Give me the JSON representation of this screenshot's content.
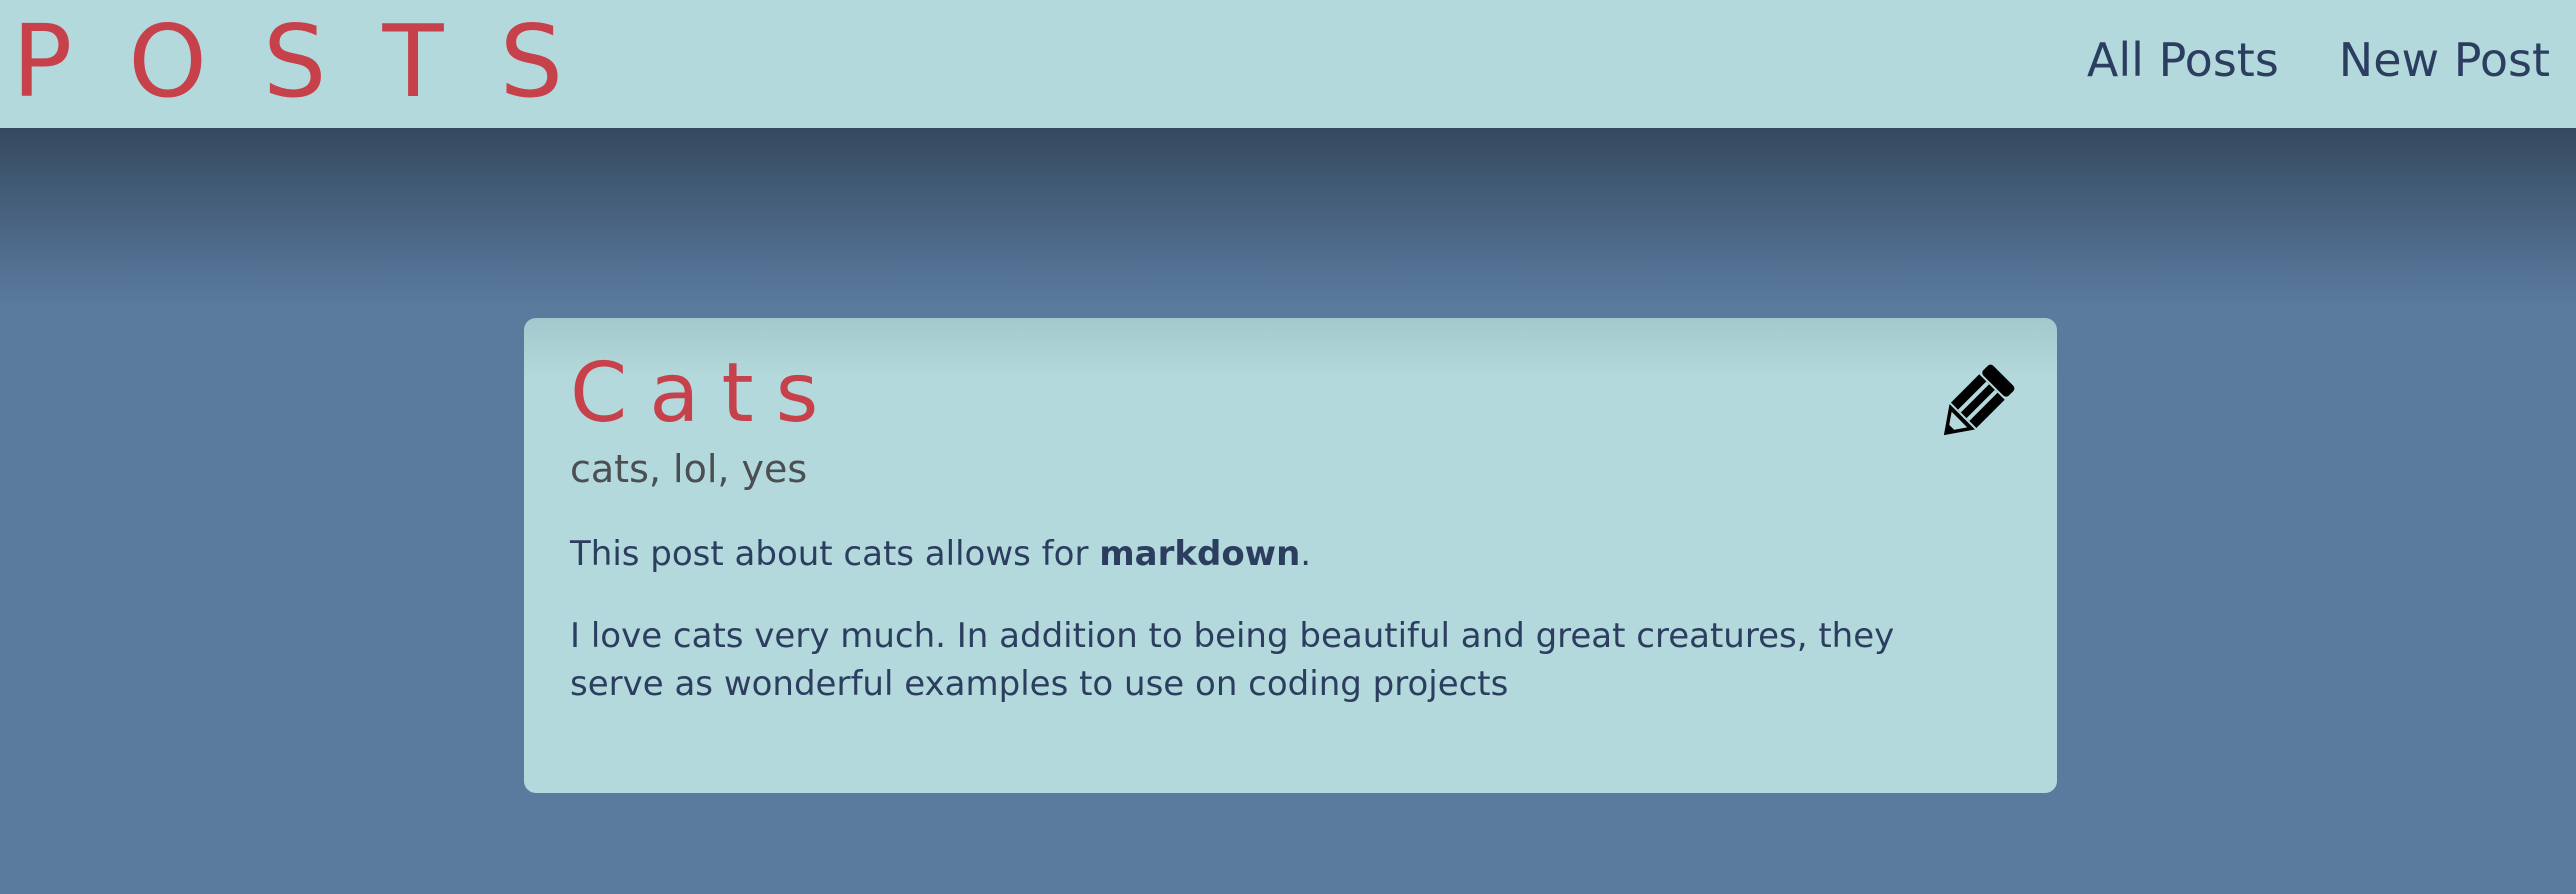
{
  "header": {
    "logo": "POSTS",
    "nav": [
      {
        "label": "All Posts"
      },
      {
        "label": "New Post"
      }
    ]
  },
  "post": {
    "title": "Cats",
    "tags": "cats, lol, yes",
    "body": {
      "p1_before": "This post about cats allows for ",
      "p1_bold": "markdown",
      "p1_after": ".",
      "p2": "I love cats very much. In addition to being beautiful and great creatures, they serve as wonderful examples to use on coding projects"
    },
    "edit_icon": "pencil-icon"
  },
  "colors": {
    "header_bg": "#b4d9dc",
    "page_bg": "#5a7b9d",
    "accent": "#c7414b",
    "text": "#2c3e60",
    "tags_text": "#4b4f52"
  }
}
